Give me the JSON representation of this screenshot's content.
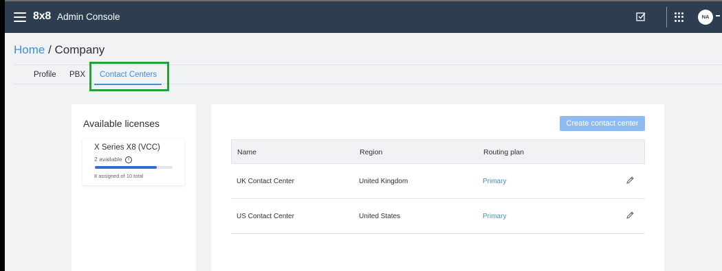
{
  "header": {
    "brand": "8x8",
    "title": "Admin Console",
    "avatar_initials": "NA"
  },
  "breadcrumb": {
    "home": "Home",
    "separator": " / ",
    "current": "Company"
  },
  "tabs": [
    {
      "label": "Profile"
    },
    {
      "label": "PBX"
    },
    {
      "label": "Contact Centers",
      "active": true
    }
  ],
  "licenses": {
    "heading": "Available licenses",
    "item": {
      "name": "X Series X8 (VCC)",
      "available": "2 available",
      "assigned_text": "8 assigned of 10 total",
      "assigned": 8,
      "total": 10
    }
  },
  "contact_centers": {
    "create_button": "Create contact center",
    "columns": {
      "name": "Name",
      "region": "Region",
      "routing_plan": "Routing plan"
    },
    "rows": [
      {
        "name": "UK Contact Center",
        "region": "United Kingdom",
        "routing_plan": "Primary"
      },
      {
        "name": "US Contact Center",
        "region": "United States",
        "routing_plan": "Primary"
      }
    ]
  },
  "colors": {
    "topbar": "#2d3e50",
    "accent": "#3f8fd9",
    "highlight": "#24a03a",
    "button_disabled": "#8fbcf0"
  },
  "icons": [
    "menu-icon",
    "checkbox-icon",
    "apps-grid-icon",
    "info-icon",
    "pencil-icon"
  ]
}
